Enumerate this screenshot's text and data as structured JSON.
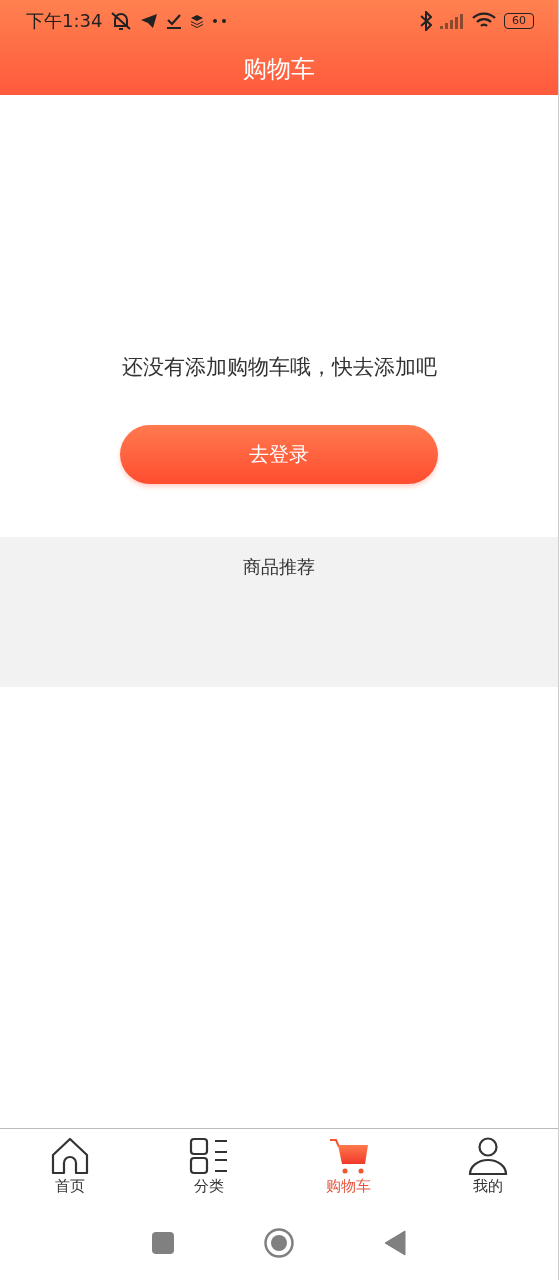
{
  "status_bar": {
    "time": "下午1:34",
    "battery": "60"
  },
  "header": {
    "title": "购物车"
  },
  "empty_state": {
    "message": "还没有添加购物车哦，快去添加吧",
    "button": "去登录"
  },
  "recommendations": {
    "title": "商品推荐"
  },
  "tab_bar": [
    {
      "label": "首页",
      "kind": "home",
      "selected": false
    },
    {
      "label": "分类",
      "kind": "category",
      "selected": false
    },
    {
      "label": "购物车",
      "kind": "cart",
      "selected": true
    },
    {
      "label": "我的",
      "kind": "profile",
      "selected": false
    }
  ]
}
